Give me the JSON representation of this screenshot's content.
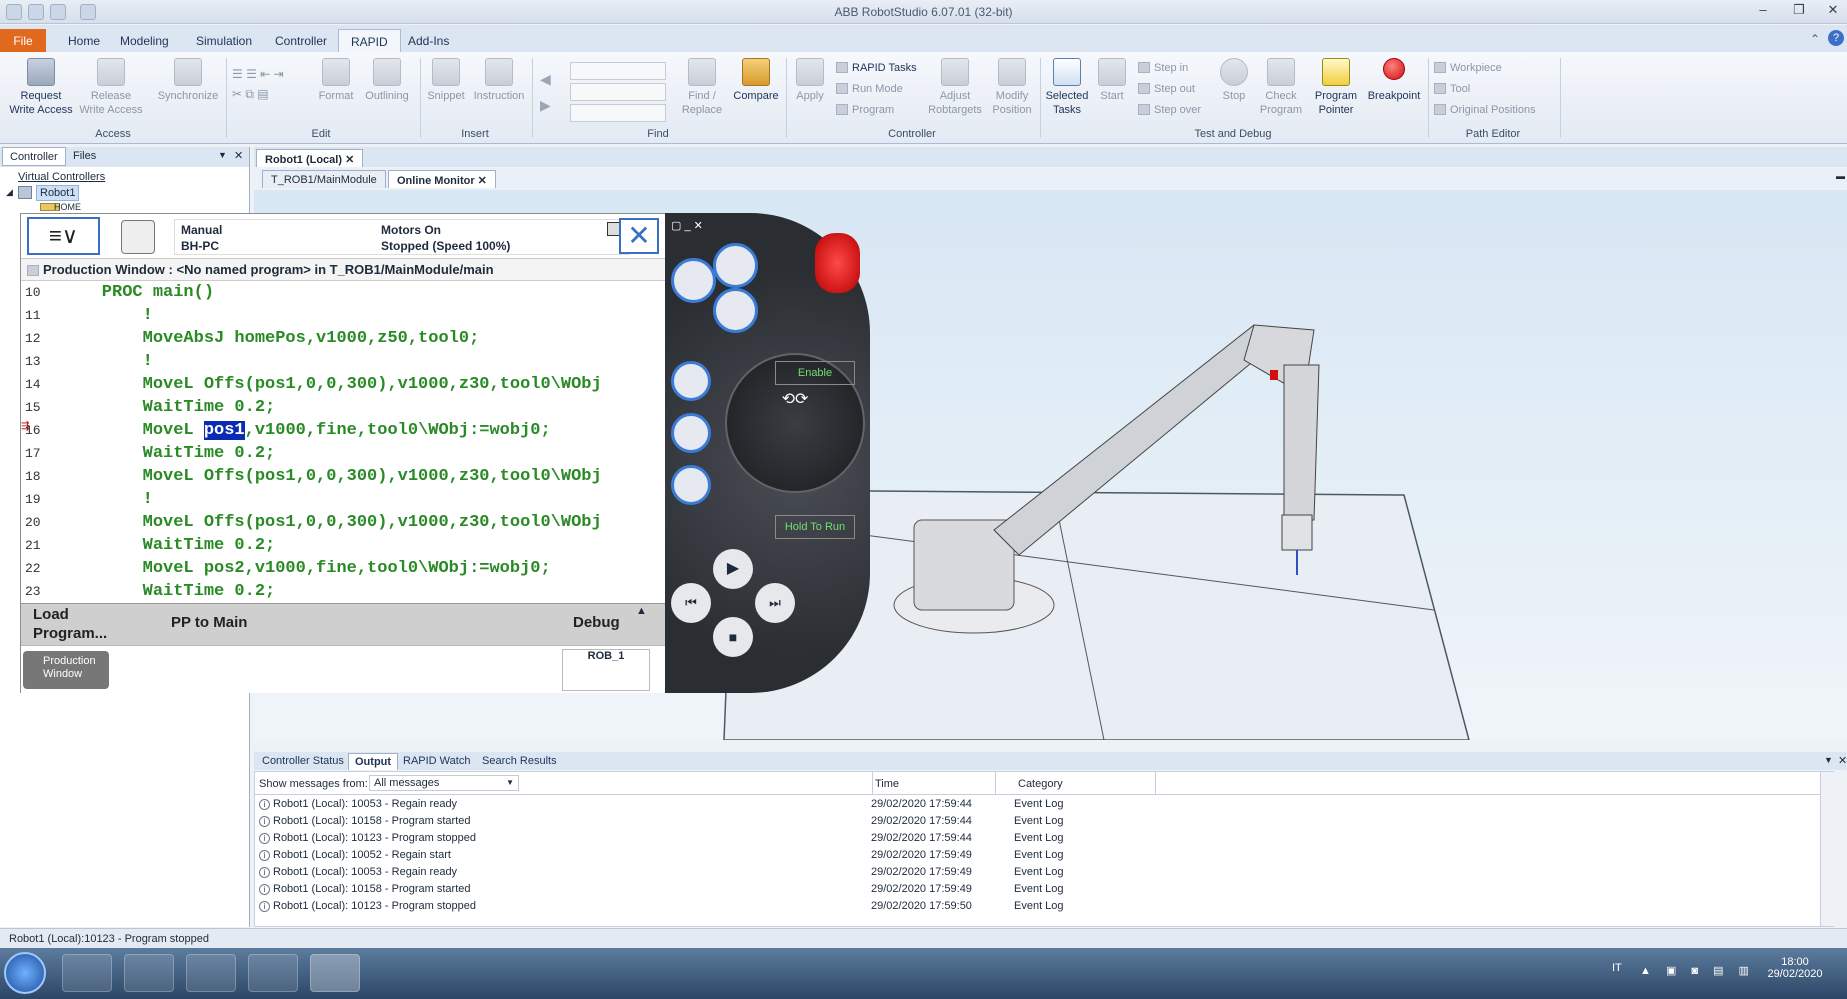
{
  "window": {
    "title": "ABB RobotStudio 6.07.01 (32-bit)"
  },
  "ribbon_tabs": [
    "File",
    "Home",
    "Modeling",
    "Simulation",
    "Controller",
    "RAPID",
    "Add-Ins"
  ],
  "ribbon": {
    "access": {
      "request": "Request\nWrite Access",
      "release": "Release\nWrite Access",
      "synchronize": "Synchronize",
      "group": "Access"
    },
    "edit": {
      "format": "Format",
      "outlining": "Outlining",
      "group": "Edit"
    },
    "insert": {
      "snippet": "Snippet",
      "instruction": "Instruction",
      "group": "Insert"
    },
    "find": {
      "find_replace": "Find /\nReplace",
      "compare": "Compare",
      "group": "Find"
    },
    "controller": {
      "apply": "Apply",
      "rapid_tasks": "RAPID Tasks",
      "run_mode": "Run Mode",
      "program": "Program",
      "adjust": "Adjust\nRobtargets",
      "modify": "Modify\nPosition",
      "group": "Controller"
    },
    "test": {
      "selected_tasks": "Selected\nTasks",
      "start": "Start",
      "step_in": "Step in",
      "step_out": "Step out",
      "step_over": "Step over",
      "stop": "Stop",
      "check": "Check\nProgram",
      "pp": "Program\nPointer",
      "breakpoint": "Breakpoint",
      "group": "Test and Debug"
    },
    "path": {
      "workpiece": "Workpiece",
      "tool": "Tool",
      "original": "Original Positions",
      "group": "Path Editor"
    }
  },
  "left_panel": {
    "tabs": [
      "Controller",
      "Files"
    ],
    "tree_root": "Virtual Controllers",
    "robot": "Robot1",
    "child": "HOME"
  },
  "doc_tabs": {
    "main": "Robot1 (Local)",
    "sub": [
      "T_ROB1/MainModule",
      "Online Monitor"
    ]
  },
  "flexpendant": {
    "mode": "Manual",
    "host": "BH-PC",
    "motors": "Motors On",
    "state": "Stopped (Speed 100%)",
    "window_title": "Production Window : <No named program> in T_ROB1/MainModule/main",
    "code_lines": [
      {
        "n": "10",
        "pre": "    PROC main()",
        "hl": "",
        "post": ""
      },
      {
        "n": "11",
        "pre": "        !",
        "hl": "",
        "post": ""
      },
      {
        "n": "12",
        "pre": "        MoveAbsJ homePos,v1000,z50,tool0;",
        "hl": "",
        "post": ""
      },
      {
        "n": "13",
        "pre": "        !",
        "hl": "",
        "post": ""
      },
      {
        "n": "14",
        "pre": "        MoveL Offs(pos1,0,0,300),v1000,z30,tool0\\WObj",
        "hl": "",
        "post": ""
      },
      {
        "n": "15",
        "pre": "        WaitTime 0.2;",
        "hl": "",
        "post": ""
      },
      {
        "n": "16",
        "pre": "        MoveL ",
        "hl": "pos1",
        "post": ",v1000,fine,tool0\\WObj:=wobj0;"
      },
      {
        "n": "17",
        "pre": "        WaitTime 0.2;",
        "hl": "",
        "post": ""
      },
      {
        "n": "18",
        "pre": "        MoveL Offs(pos1,0,0,300),v1000,z30,tool0\\WObj",
        "hl": "",
        "post": ""
      },
      {
        "n": "19",
        "pre": "        !",
        "hl": "",
        "post": ""
      },
      {
        "n": "20",
        "pre": "        MoveL Offs(pos1,0,0,300),v1000,z30,tool0\\WObj",
        "hl": "",
        "post": ""
      },
      {
        "n": "21",
        "pre": "        WaitTime 0.2;",
        "hl": "",
        "post": ""
      },
      {
        "n": "22",
        "pre": "        MoveL pos2,v1000,fine,tool0\\WObj:=wobj0;",
        "hl": "",
        "post": ""
      },
      {
        "n": "23",
        "pre": "        WaitTime 0.2;",
        "hl": "",
        "post": ""
      }
    ],
    "commands": {
      "load": "Load\nProgram...",
      "pp_main": "PP to Main",
      "debug": "Debug"
    },
    "task_button": "Production\nWindow",
    "rob_label": "ROB_1"
  },
  "pendant": {
    "enable": "Enable",
    "hold": "Hold To Run"
  },
  "output": {
    "tabs": [
      "Controller Status",
      "Output",
      "RAPID Watch",
      "Search Results"
    ],
    "filter_label": "Show messages from:",
    "filter_value": "All messages",
    "columns": {
      "time": "Time",
      "category": "Category"
    },
    "rows": [
      {
        "msg": "Robot1 (Local): 10053 - Regain ready",
        "time": "29/02/2020 17:59:44",
        "cat": "Event Log"
      },
      {
        "msg": "Robot1 (Local): 10158 - Program started",
        "time": "29/02/2020 17:59:44",
        "cat": "Event Log"
      },
      {
        "msg": "Robot1 (Local): 10123 - Program stopped",
        "time": "29/02/2020 17:59:44",
        "cat": "Event Log"
      },
      {
        "msg": "Robot1 (Local): 10052 - Regain start",
        "time": "29/02/2020 17:59:49",
        "cat": "Event Log"
      },
      {
        "msg": "Robot1 (Local): 10053 - Regain ready",
        "time": "29/02/2020 17:59:49",
        "cat": "Event Log"
      },
      {
        "msg": "Robot1 (Local): 10158 - Program started",
        "time": "29/02/2020 17:59:49",
        "cat": "Event Log"
      },
      {
        "msg": "Robot1 (Local): 10123 - Program stopped",
        "time": "29/02/2020 17:59:50",
        "cat": "Event Log"
      }
    ]
  },
  "status": {
    "text": "Robot1 (Local):10123 - Program stopped"
  },
  "tray": {
    "lang": "IT",
    "time": "18:00",
    "date": "29/02/2020"
  }
}
